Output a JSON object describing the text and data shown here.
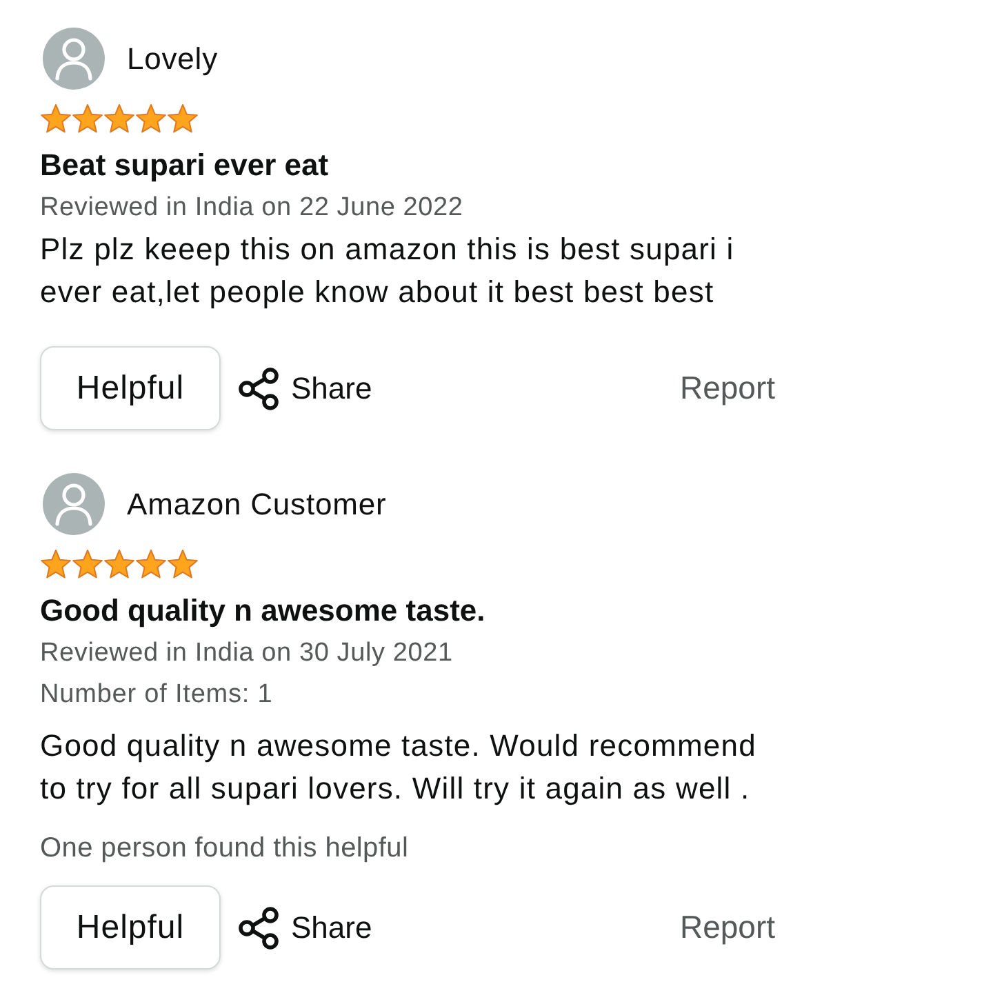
{
  "reviews": [
    {
      "reviewer": "Lovely",
      "stars": 5,
      "title": "Beat supari ever eat",
      "date": "Reviewed in India on 22 June 2022",
      "body": "Plz plz keeep this on amazon this is best supari i ever eat,let people know about it best best best",
      "actions": {
        "helpful": "Helpful",
        "share": "Share",
        "report": "Report"
      }
    },
    {
      "reviewer": "Amazon Customer",
      "stars": 5,
      "title": "Good quality n awesome taste.",
      "date": "Reviewed in India on 30 July 2021",
      "item_count": "Number of Items: 1",
      "body": "Good quality n awesome taste. Would recommend to try for all supari lovers. Will try it again as well .",
      "helpful_count": "One person found this helpful",
      "actions": {
        "helpful": "Helpful",
        "share": "Share",
        "report": "Report"
      }
    }
  ]
}
